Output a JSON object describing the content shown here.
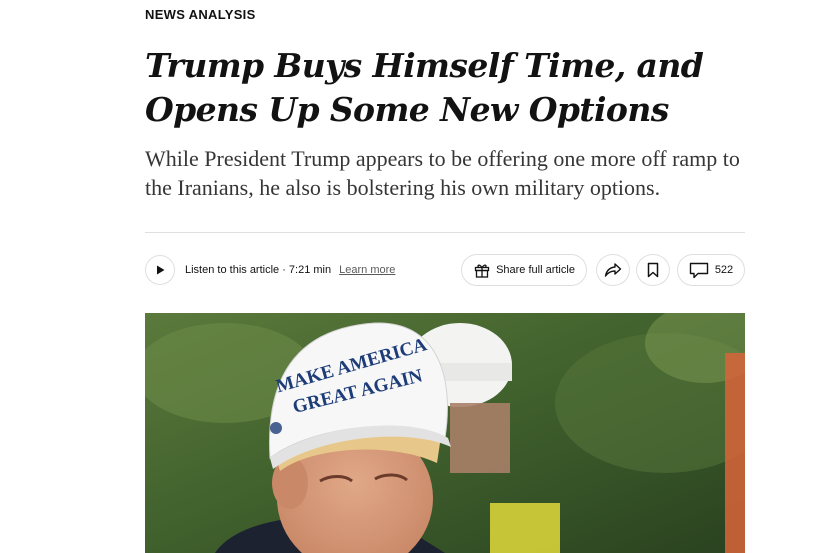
{
  "article": {
    "kicker": "NEWS ANALYSIS",
    "headline": "Trump Buys Himself Time, and Opens Up Some New Options",
    "summary": "While President Trump appears to be offering one more off ramp to the Iranians, he also is bolstering his own military options."
  },
  "toolbar": {
    "listen_label": "Listen to this article · 7:21 min",
    "learn_more_label": "Learn more",
    "share_full_label": "Share full article",
    "comments_count": "522",
    "icons": {
      "play": "play-icon",
      "gift": "gift-icon",
      "share": "share-arrow-icon",
      "bookmark": "bookmark-icon",
      "comment": "comment-icon"
    }
  },
  "photo": {
    "hat_text_line1": "MAKE AMERICA",
    "hat_text_line2": "GREAT AGAIN"
  },
  "colors": {
    "text": "#121212",
    "summary": "#363636",
    "border": "#dfdfdf",
    "hat_text": "#1d3c78"
  }
}
